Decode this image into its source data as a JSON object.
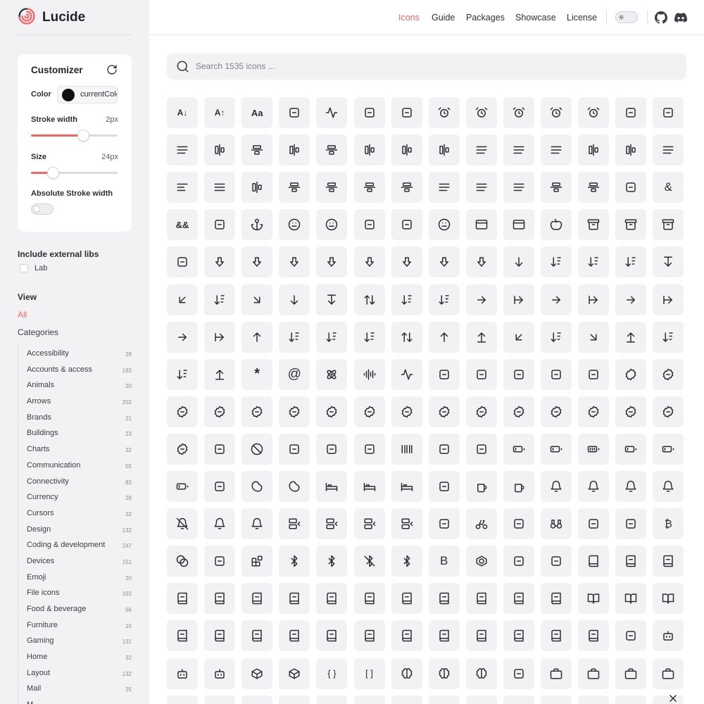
{
  "brand": {
    "name": "Lucide",
    "color": "#f56565"
  },
  "nav": {
    "links": [
      "Icons",
      "Guide",
      "Packages",
      "Showcase",
      "License"
    ],
    "active": "Icons"
  },
  "customizer": {
    "title": "Customizer",
    "color_label": "Color",
    "color_value": "currentColor",
    "stroke_label": "Stroke width",
    "stroke_value": "2px",
    "stroke_level": 0.6,
    "size_label": "Size",
    "size_value": "24px",
    "size_level": 0.25,
    "absolute_label": "Absolute Stroke width",
    "absolute_on": false
  },
  "external": {
    "heading": "Include external libs",
    "lab_label": "Lab"
  },
  "view": {
    "heading": "View",
    "all_label": "All",
    "categories_heading": "Categories"
  },
  "categories": [
    {
      "name": "Accessibility",
      "count": "28"
    },
    {
      "name": "Accounts & access",
      "count": "193"
    },
    {
      "name": "Animals",
      "count": "20"
    },
    {
      "name": "Arrows",
      "count": "202"
    },
    {
      "name": "Brands",
      "count": "21"
    },
    {
      "name": "Buildings",
      "count": "23"
    },
    {
      "name": "Charts",
      "count": "32"
    },
    {
      "name": "Communication",
      "count": "55"
    },
    {
      "name": "Connectivity",
      "count": "83"
    },
    {
      "name": "Currency",
      "count": "28"
    },
    {
      "name": "Cursors",
      "count": "32"
    },
    {
      "name": "Design",
      "count": "132"
    },
    {
      "name": "Coding & development",
      "count": "247"
    },
    {
      "name": "Devices",
      "count": "151"
    },
    {
      "name": "Emoji",
      "count": "20"
    },
    {
      "name": "File icons",
      "count": "163"
    },
    {
      "name": "Food & beverage",
      "count": "66"
    },
    {
      "name": "Furniture",
      "count": "15"
    },
    {
      "name": "Gaming",
      "count": "131"
    },
    {
      "name": "Home",
      "count": "32"
    },
    {
      "name": "Layout",
      "count": "132"
    },
    {
      "name": "Mail",
      "count": "25"
    },
    {
      "name": "M",
      "count": ""
    }
  ],
  "search": {
    "placeholder": "Search 1535 icons ..."
  },
  "icons": [
    [
      "a-arrow-down",
      "a-arrow-up",
      "a-large-small",
      "accessibility",
      "activity",
      "air-vent",
      "airplay",
      "alarm-clock",
      "alarm-clock-check",
      "alarm-clock-minus",
      "alarm-clock-off",
      "alarm-clock-plus",
      "alarm-smoke",
      "album"
    ],
    [
      "align-center",
      "align-center-horizontal",
      "align-center-vertical",
      "align-end-horizontal",
      "align-end-vertical",
      "align-horizontal-distribute-center",
      "align-horizontal-distribute-end",
      "align-horizontal-distribute-start",
      "align-horizontal-justify-center",
      "align-horizontal-justify-end",
      "align-horizontal-justify-start",
      "align-horizontal-space-around",
      "align-horizontal-space-between",
      "align-justify"
    ],
    [
      "align-left",
      "align-right",
      "align-start-horizontal",
      "align-start-vertical",
      "align-vertical-distribute-center",
      "align-vertical-distribute-end",
      "align-vertical-distribute-start",
      "align-vertical-justify-center",
      "align-vertical-justify-end",
      "align-vertical-justify-start",
      "align-vertical-space-around",
      "align-vertical-space-between",
      "ambulance",
      "ampersand"
    ],
    [
      "ampersands",
      "amphora",
      "anchor",
      "angry",
      "annoyed",
      "antenna",
      "anvil",
      "aperture",
      "app-window",
      "app-window-mac",
      "apple",
      "archive",
      "archive-restore",
      "archive-x"
    ],
    [
      "armchair",
      "arrow-big-down",
      "arrow-big-down-dash",
      "arrow-big-left",
      "arrow-big-left-dash",
      "arrow-big-right",
      "arrow-big-right-dash",
      "arrow-big-up",
      "arrow-big-up-dash",
      "arrow-down",
      "arrow-down-0-1",
      "arrow-down-1-0",
      "arrow-down-a-z",
      "arrow-down-from-line"
    ],
    [
      "arrow-down-left",
      "arrow-down-narrow-wide",
      "arrow-down-right",
      "arrow-down-to-dot",
      "arrow-down-to-line",
      "arrow-down-up",
      "arrow-down-wide-narrow",
      "arrow-down-z-a",
      "arrow-left",
      "arrow-left-from-line",
      "arrow-left-right",
      "arrow-left-to-line",
      "arrow-right",
      "arrow-right-from-line"
    ],
    [
      "arrow-right-left",
      "arrow-right-to-line",
      "arrow-up",
      "arrow-up-0-1",
      "arrow-up-1-0",
      "arrow-up-a-z",
      "arrow-up-down",
      "arrow-up-from-dot",
      "arrow-up-from-line",
      "arrow-up-left",
      "arrow-up-narrow-wide",
      "arrow-up-right",
      "arrow-up-to-line",
      "arrow-up-wide-narrow"
    ],
    [
      "arrow-up-z-a",
      "arrows-up-from-line",
      "asterisk",
      "at-sign",
      "atom",
      "audio-lines",
      "audio-waveform",
      "award",
      "axe",
      "axis-3d",
      "baby",
      "backpack",
      "badge",
      "badge-alert"
    ],
    [
      "badge-cent",
      "badge-check",
      "badge-dollar-sign",
      "badge-euro",
      "badge-help",
      "badge-indian-rupee",
      "badge-info",
      "badge-japanese-yen",
      "badge-minus",
      "badge-percent",
      "badge-plus",
      "badge-pound-sterling",
      "badge-russian-ruble",
      "badge-swiss-franc"
    ],
    [
      "badge-x",
      "baggage-claim",
      "ban",
      "banana",
      "banknote",
      "banknote-small",
      "barcode",
      "baseline",
      "bath",
      "battery",
      "battery-charging",
      "battery-full",
      "battery-low",
      "battery-medium"
    ],
    [
      "battery-warning",
      "beaker",
      "bean",
      "bean-off",
      "bed",
      "bed-double",
      "bed-single",
      "beef",
      "beer",
      "beer-off",
      "bell",
      "bell-dot",
      "bell-electric",
      "bell-minus"
    ],
    [
      "bell-off",
      "bell-plus",
      "bell-ring",
      "between-horizontal-end",
      "between-horizontal-start",
      "between-vertical-end",
      "between-vertical-start",
      "biceps-flexed",
      "bike",
      "binary",
      "binoculars",
      "biohazard",
      "bird",
      "bitcoin"
    ],
    [
      "blend",
      "blinds",
      "blocks",
      "bluetooth",
      "bluetooth-connected",
      "bluetooth-off",
      "bluetooth-searching",
      "bold",
      "bolt",
      "bomb",
      "bone",
      "book",
      "book-a",
      "book-audio"
    ],
    [
      "book-check",
      "book-copy",
      "book-dashed",
      "book-down",
      "book-headphones",
      "book-heart",
      "book-image",
      "book-key",
      "book-lock",
      "book-marked",
      "book-minus",
      "book-open",
      "book-open-check",
      "book-open-text"
    ],
    [
      "book-plus",
      "book-text",
      "book-type",
      "book-up",
      "book-up-2",
      "book-user",
      "book-x",
      "bookmark",
      "bookmark-check",
      "bookmark-minus",
      "bookmark-plus",
      "bookmark-x",
      "boom-box",
      "bot"
    ],
    [
      "bot-message-square",
      "bot-off",
      "box",
      "boxes",
      "braces",
      "brackets",
      "brain",
      "brain-circuit",
      "brain-cog",
      "brick-wall",
      "briefcase",
      "briefcase-business",
      "briefcase-conveyor-belt",
      "briefcase-medical"
    ],
    [
      "bring-to-front",
      "brush",
      "bug",
      "bug-off",
      "bug-play",
      "building",
      "building-2",
      "bus",
      "bus-front",
      "cable",
      "cable-car",
      "cake",
      "cake-slice",
      "calculator"
    ]
  ],
  "colors": {
    "accent": "#f56565",
    "tile": "#f2f2f5",
    "sidebar": "#f2f2f5",
    "icon": "#2b2f33"
  }
}
